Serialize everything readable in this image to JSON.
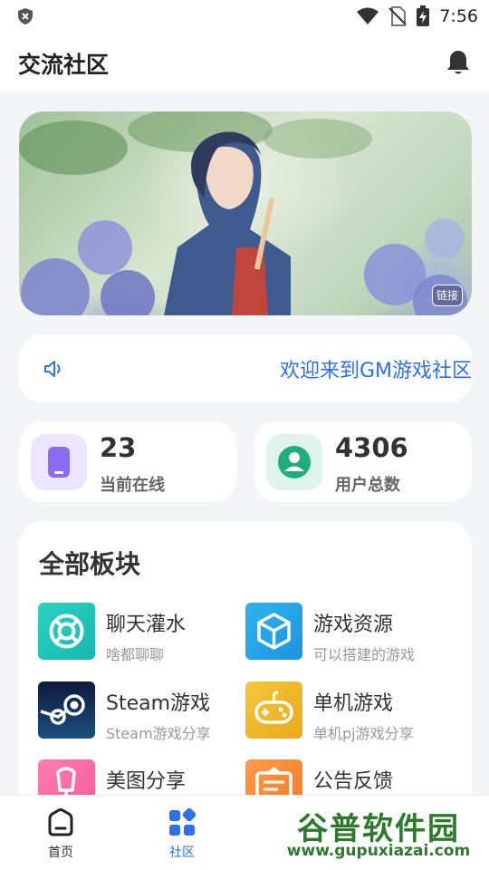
{
  "status_bar": {
    "time": "7:56",
    "icons": [
      "shield-icon",
      "wifi-icon",
      "no-sim-icon",
      "battery-charging-icon"
    ]
  },
  "header": {
    "title": "交流社区",
    "notification_icon": "bell-icon"
  },
  "banner": {
    "badge": "链接"
  },
  "notice": {
    "icon": "speaker-icon",
    "text": "欢迎来到GM游戏社区"
  },
  "stats": {
    "online": {
      "value": "23",
      "label": "当前在线",
      "icon": "phone-icon",
      "color": "#8b6cf0"
    },
    "users": {
      "value": "4306",
      "label": "用户总数",
      "icon": "user-icon",
      "color": "#1fae7a"
    }
  },
  "sections": {
    "title": "全部板块",
    "items": [
      {
        "name": "聊天灌水",
        "desc": "啥都聊聊",
        "icon": "lifebuoy-icon"
      },
      {
        "name": "游戏资源",
        "desc": "可以搭建的游戏",
        "icon": "cube-icon"
      },
      {
        "name": "Steam游戏",
        "desc": "Steam游戏分享",
        "icon": "steam-icon"
      },
      {
        "name": "单机游戏",
        "desc": "单机pj游戏分享",
        "icon": "gamepad-icon"
      },
      {
        "name": "美图分享",
        "desc": "",
        "icon": "popsicle-icon"
      },
      {
        "name": "公告反馈",
        "desc": "",
        "icon": "notice-board-icon"
      }
    ]
  },
  "bottom_nav": {
    "items": [
      {
        "label": "首页",
        "icon": "home-icon",
        "active": false
      },
      {
        "label": "社区",
        "icon": "grid-icon",
        "active": true
      }
    ],
    "active_color": "#2f6fe8"
  },
  "watermark": {
    "main": "谷普软件园",
    "sub": "www.gupuxiazai.com"
  }
}
